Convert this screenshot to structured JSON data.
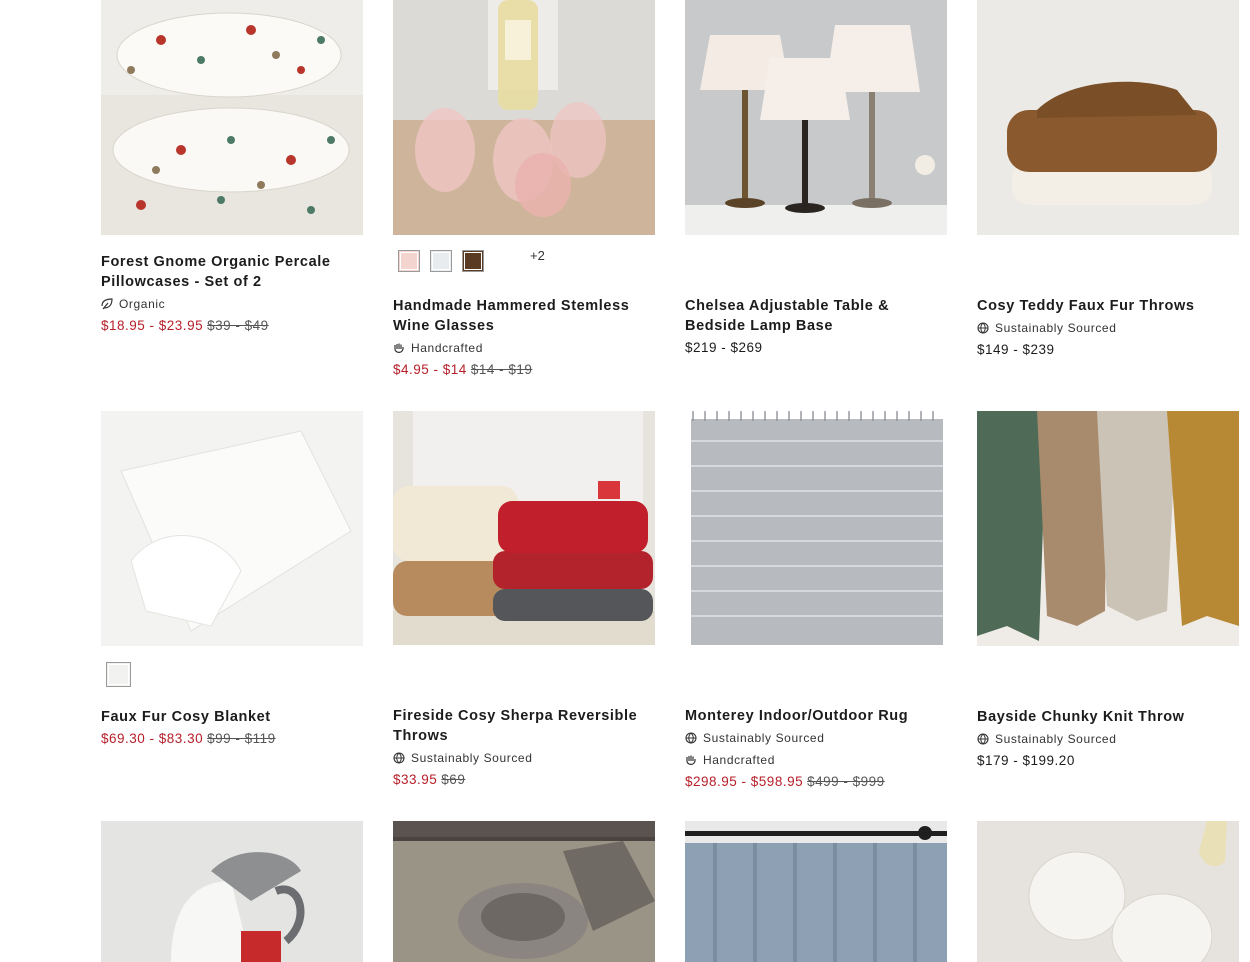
{
  "products": [
    {
      "title": "Forest Gnome Organic Percale Pillowcases - Set of 2",
      "badges": [
        {
          "icon": "leaf-icon",
          "label": "Organic"
        }
      ],
      "sale_price": "$18.95 - $23.95",
      "orig_price": "$39 - $49"
    },
    {
      "title": "Handmade Hammered Stemless Wine Glasses",
      "swatches": [
        "#f4d4cf",
        "#e8ecee",
        "#5a3a22"
      ],
      "swatch_more": "+2",
      "badges": [
        {
          "icon": "hand-icon",
          "label": "Handcrafted"
        }
      ],
      "sale_price": "$4.95 - $14",
      "orig_price": "$14 - $19"
    },
    {
      "title": "Chelsea Adjustable Table & Bedside Lamp Base",
      "price": "$219 - $269"
    },
    {
      "title": "Cosy Teddy Faux Fur Throws",
      "badges": [
        {
          "icon": "globe-icon",
          "label": "Sustainably Sourced"
        }
      ],
      "price": "$149 - $239"
    },
    {
      "title": "Faux Fur Cosy Blanket",
      "swatches": [
        "#f2f2f0"
      ],
      "sale_price": "$69.30 - $83.30",
      "orig_price": "$99 - $119"
    },
    {
      "title": "Fireside Cosy Sherpa Reversible Throws",
      "badges": [
        {
          "icon": "globe-icon",
          "label": "Sustainably Sourced"
        }
      ],
      "sale_price": "$33.95",
      "orig_price": "$69"
    },
    {
      "title": "Monterey Indoor/Outdoor Rug",
      "badges": [
        {
          "icon": "globe-icon",
          "label": "Sustainably Sourced"
        },
        {
          "icon": "hand-icon",
          "label": "Handcrafted"
        }
      ],
      "sale_price": "$298.95 - $598.95",
      "orig_price": "$499 - $999"
    },
    {
      "title": "Bayside Chunky Knit Throw",
      "badges": [
        {
          "icon": "globe-icon",
          "label": "Sustainably Sourced"
        }
      ],
      "price": "$179 - $199.20"
    }
  ],
  "colors": {
    "sale": "#b6202a",
    "text": "#1c1c1c"
  }
}
